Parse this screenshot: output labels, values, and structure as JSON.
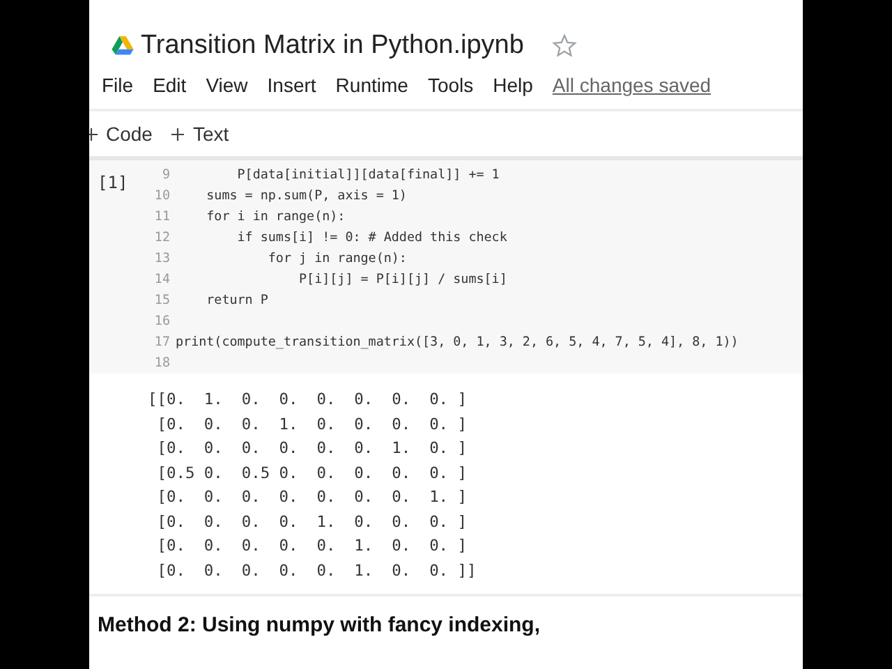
{
  "notebook": {
    "title": "Transition Matrix in Python.ipynb",
    "starred": false
  },
  "menu": [
    "File",
    "Edit",
    "View",
    "Insert",
    "Runtime",
    "Tools",
    "Help"
  ],
  "save_status": "All changes saved",
  "toolbar": [
    "Code",
    "Text"
  ],
  "cell": {
    "execution_count": "[1]",
    "lines": [
      {
        "number": "9",
        "code": "        P[data[initial]][data[final]] += 1"
      },
      {
        "number": "10",
        "code": "    sums = np.sum(P, axis = 1)"
      },
      {
        "number": "11",
        "code": "    for i in range(n):"
      },
      {
        "number": "12",
        "code": "        if sums[i] != 0: # Added this check"
      },
      {
        "number": "13",
        "code": "            for j in range(n):"
      },
      {
        "number": "14",
        "code": "                P[i][j] = P[i][j] / sums[i]"
      },
      {
        "number": "15",
        "code": "    return P"
      },
      {
        "number": "16"
      },
      {
        "number": "17",
        "code": "print(compute_transition_matrix([3, 0, 1, 3, 2, 6, 5, 4, 7, 5, 4], 8, 1))"
      },
      {
        "number": "18"
      }
    ],
    "output": [
      "[[0.  1.  0.  0.  0.  0.  0.  0. ]",
      " [0.  0.  0.  1.  0.  0.  0.  0. ]",
      " [0.  0.  0.  0.  0.  0.  1.  0. ]",
      " [0.5 0.  0.5 0.  0.  0.  0.  0. ]",
      " [0.  0.  0.  0.  0.  0.  0.  1. ]",
      " [0.  0.  0.  0.  1.  0.  0.  0. ]",
      " [0.  0.  0.  0.  0.  1.  0.  0. ]",
      " [0.  0.  0.  0.  0.  1.  0.  0. ]]"
    ]
  },
  "text_cell": {
    "heading": "Method 2: Using numpy with fancy indexing,"
  }
}
